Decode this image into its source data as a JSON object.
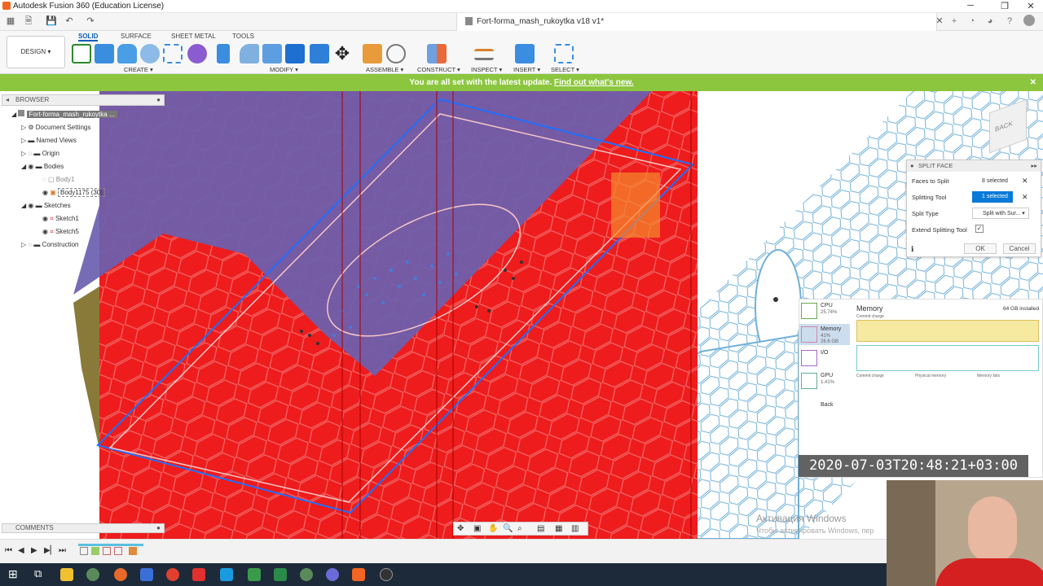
{
  "window": {
    "title": "Autodesk Fusion 360 (Education License)",
    "doc_title": "Fort-forma_mash_rukoytka v18 v1*"
  },
  "toolbar": {
    "design_label": "DESIGN",
    "tabs": [
      "SOLID",
      "SURFACE",
      "SHEET METAL",
      "TOOLS"
    ],
    "groups": [
      "CREATE",
      "MODIFY",
      "ASSEMBLE",
      "CONSTRUCT",
      "INSPECT",
      "INSERT",
      "SELECT"
    ]
  },
  "banner": {
    "text": "You are all set with the latest update.",
    "link": "Find out what's new."
  },
  "browser": {
    "title": "BROWSER",
    "root": "Fort-forma_mash_rukoytka ...",
    "nodes": [
      "Document Settings",
      "Named Views",
      "Origin",
      "Bodies",
      "Body1",
      "Body1175 (30)",
      "Sketches",
      "Sketch1",
      "Sketch5",
      "Construction"
    ]
  },
  "viewcube": {
    "label": "BACK"
  },
  "split_face": {
    "title": "SPLIT FACE",
    "faces_label": "Faces to Split",
    "faces_value": "8 selected",
    "tool_label": "Splitting Tool",
    "tool_value": "1 selected",
    "type_label": "Split Type",
    "type_value": "Split with Sur...",
    "extend_label": "Extend Splitting Tool",
    "ok": "OK",
    "cancel": "Cancel"
  },
  "taskmgr": {
    "cpu_label": "CPU",
    "cpu_value": "25.74%",
    "mem_label": "Memory",
    "mem_value": "41%",
    "mem_sub": "26.6 GB",
    "io_label": "I/O",
    "gpu_label": "GPU",
    "gpu_value": "1.41%",
    "back": "Back",
    "heading": "Memory",
    "installed": "64 GB installed",
    "commit_charge": "Commit charge",
    "physical_memory": "Physical memory",
    "memory_lists": "Memory lists"
  },
  "timestamp": "2020-07-03T20:48:21+03:00",
  "comments": {
    "label": "COMMENTS"
  },
  "watermark": {
    "line1": "Активация Windows",
    "line2": "Чтобы активировать Windows, пер"
  },
  "colors": {
    "accent": "#0a5fb5",
    "banner": "#8cc63f",
    "model_red": "#ee1c1c",
    "surface_blue": "#6a5fb0",
    "taskbar": "#1c2a3a"
  }
}
